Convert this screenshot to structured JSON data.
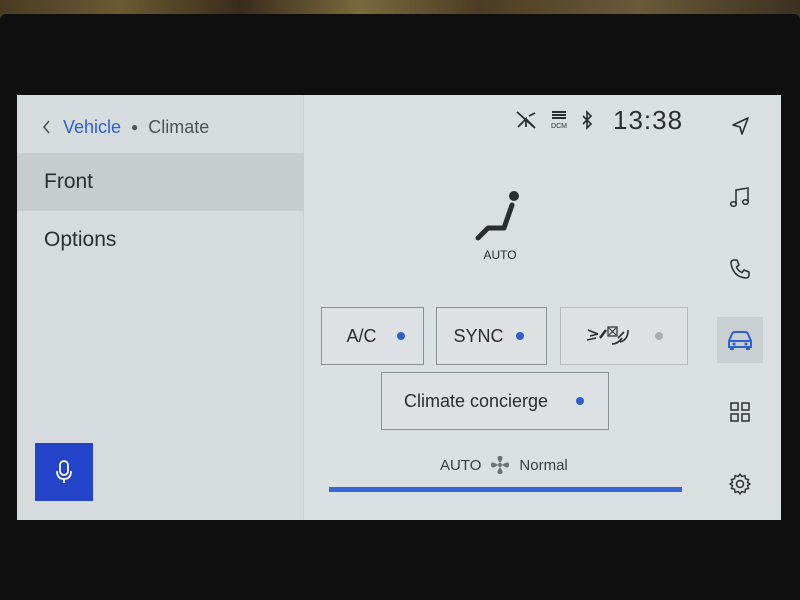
{
  "breadcrumb": {
    "parent": "Vehicle",
    "current": "Climate"
  },
  "menu": {
    "front": "Front",
    "options": "Options"
  },
  "status": {
    "clock": "13:38",
    "dcm": "DCM"
  },
  "seat": {
    "mode": "AUTO"
  },
  "buttons": {
    "ac": "A/C",
    "sync": "SYNC",
    "concierge": "Climate concierge"
  },
  "fan": {
    "mode": "AUTO",
    "level_label": "Normal",
    "level": 1.0
  },
  "colors": {
    "accent": "#2f5fd0",
    "voice_button": "#2344c9",
    "screen_bg": "#dadfe1"
  },
  "icons": {
    "rail": [
      "navigation-icon",
      "music-icon",
      "phone-icon",
      "car-icon",
      "apps-icon",
      "settings-icon"
    ],
    "status": [
      "signal-off-icon",
      "dcm-icon",
      "bluetooth-icon"
    ]
  }
}
